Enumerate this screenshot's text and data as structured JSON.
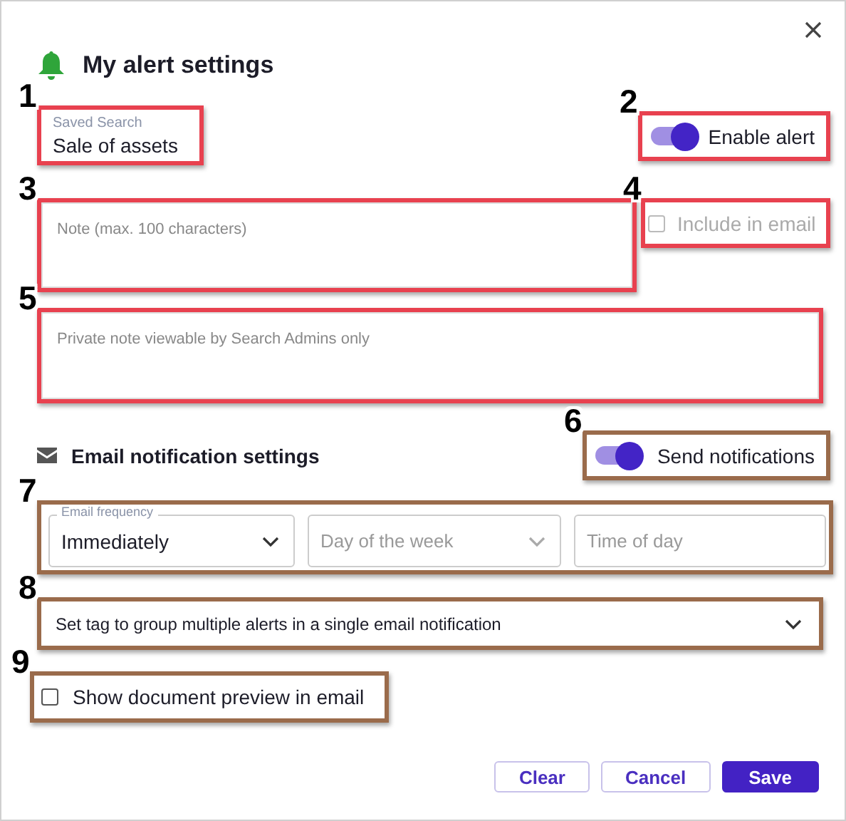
{
  "dialog": {
    "title": "My alert settings"
  },
  "saved_search": {
    "label": "Saved Search",
    "value": "Sale of assets",
    "callout": {
      "number": "1",
      "color": "#e8414f"
    }
  },
  "enable_alert": {
    "label": "Enable alert",
    "on": true,
    "callout": {
      "number": "2",
      "color": "#e8414f"
    }
  },
  "note": {
    "placeholder": "Note (max. 100 characters)",
    "callout": {
      "number": "3",
      "color": "#e8414f"
    }
  },
  "include_in_email": {
    "label": "Include in email",
    "checked": false,
    "disabled": true,
    "callout": {
      "number": "4",
      "color": "#e8414f"
    }
  },
  "private_note": {
    "placeholder": "Private note viewable by Search Admins only",
    "callout": {
      "number": "5",
      "color": "#e8414f"
    }
  },
  "email_section": {
    "title": "Email notification settings"
  },
  "send_notifications": {
    "label": "Send notifications",
    "on": true,
    "callout": {
      "number": "6",
      "color": "#9a6b4b"
    }
  },
  "schedule": {
    "callout": {
      "number": "7",
      "color": "#9a6b4b"
    },
    "frequency": {
      "label": "Email frequency",
      "value": "Immediately"
    },
    "day": {
      "placeholder": "Day of the week"
    },
    "time": {
      "placeholder": "Time of day"
    }
  },
  "tag_select": {
    "placeholder": "Set tag to group multiple alerts in a single email notification",
    "callout": {
      "number": "8",
      "color": "#9a6b4b"
    }
  },
  "show_preview": {
    "label": "Show document preview in email",
    "checked": false,
    "callout": {
      "number": "9",
      "color": "#9a6b4b"
    }
  },
  "buttons": [
    {
      "label": "Clear",
      "kind": "outline"
    },
    {
      "label": "Cancel",
      "kind": "outline"
    },
    {
      "label": "Save",
      "kind": "primary"
    }
  ]
}
